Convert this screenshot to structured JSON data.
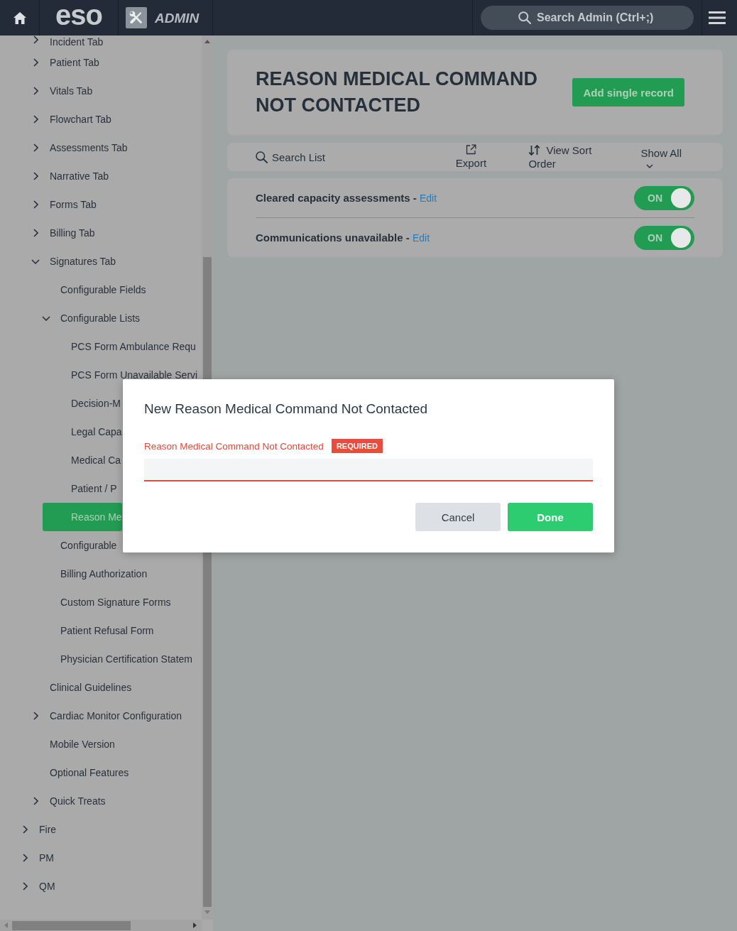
{
  "top_bar": {
    "logo": "eso",
    "section": "ADMIN",
    "search": {
      "placeholder": "Search Admin (Ctrl+;)"
    }
  },
  "sidebar": {
    "items": [
      {
        "children": [
          {
            "label": "Incident Tab",
            "kind": "group",
            "expanded": false,
            "selected": false
          },
          {
            "label": "Patient Tab",
            "kind": "group",
            "expanded": false,
            "selected": false
          },
          {
            "label": "Vitals Tab",
            "kind": "group",
            "expanded": false,
            "selected": false
          },
          {
            "label": "Flowchart Tab",
            "kind": "group",
            "expanded": false,
            "selected": false
          },
          {
            "label": "Assessments Tab",
            "kind": "group",
            "expanded": false,
            "selected": false
          },
          {
            "label": "Narrative Tab",
            "kind": "group",
            "expanded": false,
            "selected": false
          },
          {
            "label": "Forms Tab",
            "kind": "group",
            "expanded": false,
            "selected": false
          },
          {
            "label": "Billing Tab",
            "kind": "group",
            "expanded": false,
            "selected": false
          },
          {
            "label": "Signatures Tab",
            "kind": "group",
            "expanded": true,
            "selected": false,
            "children": [
              {
                "label": "Configurable Fields",
                "kind": "leaf",
                "selected": false
              },
              {
                "label": "Configurable Lists",
                "kind": "group",
                "expanded": true,
                "selected": false,
                "children": [
                  {
                    "label": "PCS Form Ambulance Requ",
                    "kind": "leaf",
                    "selected": false
                  },
                  {
                    "label": "PCS Form Unavailable Servi",
                    "kind": "leaf",
                    "selected": false
                  },
                  {
                    "label": "Decision-M",
                    "kind": "leaf",
                    "selected": false
                  },
                  {
                    "label": "Legal Capa",
                    "kind": "leaf",
                    "selected": false
                  },
                  {
                    "label": "Medical Ca",
                    "kind": "leaf",
                    "selected": false
                  },
                  {
                    "label": "Patient / P",
                    "kind": "leaf",
                    "selected": false
                  },
                  {
                    "label": "Reason Me",
                    "kind": "leaf",
                    "selected": true
                  }
                ]
              },
              {
                "label": "Configurable",
                "kind": "leaf",
                "selected": false
              },
              {
                "label": "Billing Authorization",
                "kind": "leaf",
                "selected": false
              },
              {
                "label": "Custom Signature Forms",
                "kind": "leaf",
                "selected": false
              },
              {
                "label": "Patient Refusal Form",
                "kind": "leaf",
                "selected": false
              },
              {
                "label": "Physician Certification Statem",
                "kind": "leaf",
                "selected": false
              }
            ]
          },
          {
            "label": "Clinical Guidelines",
            "kind": "leaf",
            "selected": false
          },
          {
            "label": "Cardiac Monitor Configuration",
            "kind": "group",
            "expanded": false,
            "selected": false
          },
          {
            "label": "Mobile Version",
            "kind": "leaf",
            "selected": false
          },
          {
            "label": "Optional Features",
            "kind": "leaf",
            "selected": false
          },
          {
            "label": "Quick Treats",
            "kind": "group",
            "expanded": false,
            "selected": false
          }
        ]
      },
      {
        "label": "Fire",
        "kind": "group",
        "expanded": false,
        "selected": false
      },
      {
        "label": "PM",
        "kind": "group",
        "expanded": false,
        "selected": false
      },
      {
        "label": "QM",
        "kind": "group",
        "expanded": false,
        "selected": false
      }
    ]
  },
  "page": {
    "title": "REASON MEDICAL COMMAND NOT CONTACTED",
    "primary_action": "Add single record"
  },
  "toolbar": {
    "search": "Search List",
    "actions": [
      {
        "label": "Export",
        "kind": "export"
      },
      {
        "label": "View Sort Order",
        "kind": "sort"
      },
      {
        "label": "Show All",
        "kind": "filter"
      }
    ]
  },
  "records": [
    {
      "label": "Cleared capacity assessments -",
      "link": "Edit",
      "toggle": {
        "on": true,
        "text": "ON"
      }
    },
    {
      "label": "Communications unavailable -",
      "link": "Edit",
      "toggle": {
        "on": true,
        "text": "ON"
      }
    }
  ],
  "dialog": {
    "title": "New Reason Medical Command Not Contacted",
    "field": {
      "label": "Reason Medical Command Not Contacted",
      "badge": "REQUIRED",
      "invalid": true
    },
    "buttons": [
      {
        "label": "Cancel",
        "kind": "secondary"
      },
      {
        "label": "Done",
        "kind": "primary"
      }
    ]
  }
}
